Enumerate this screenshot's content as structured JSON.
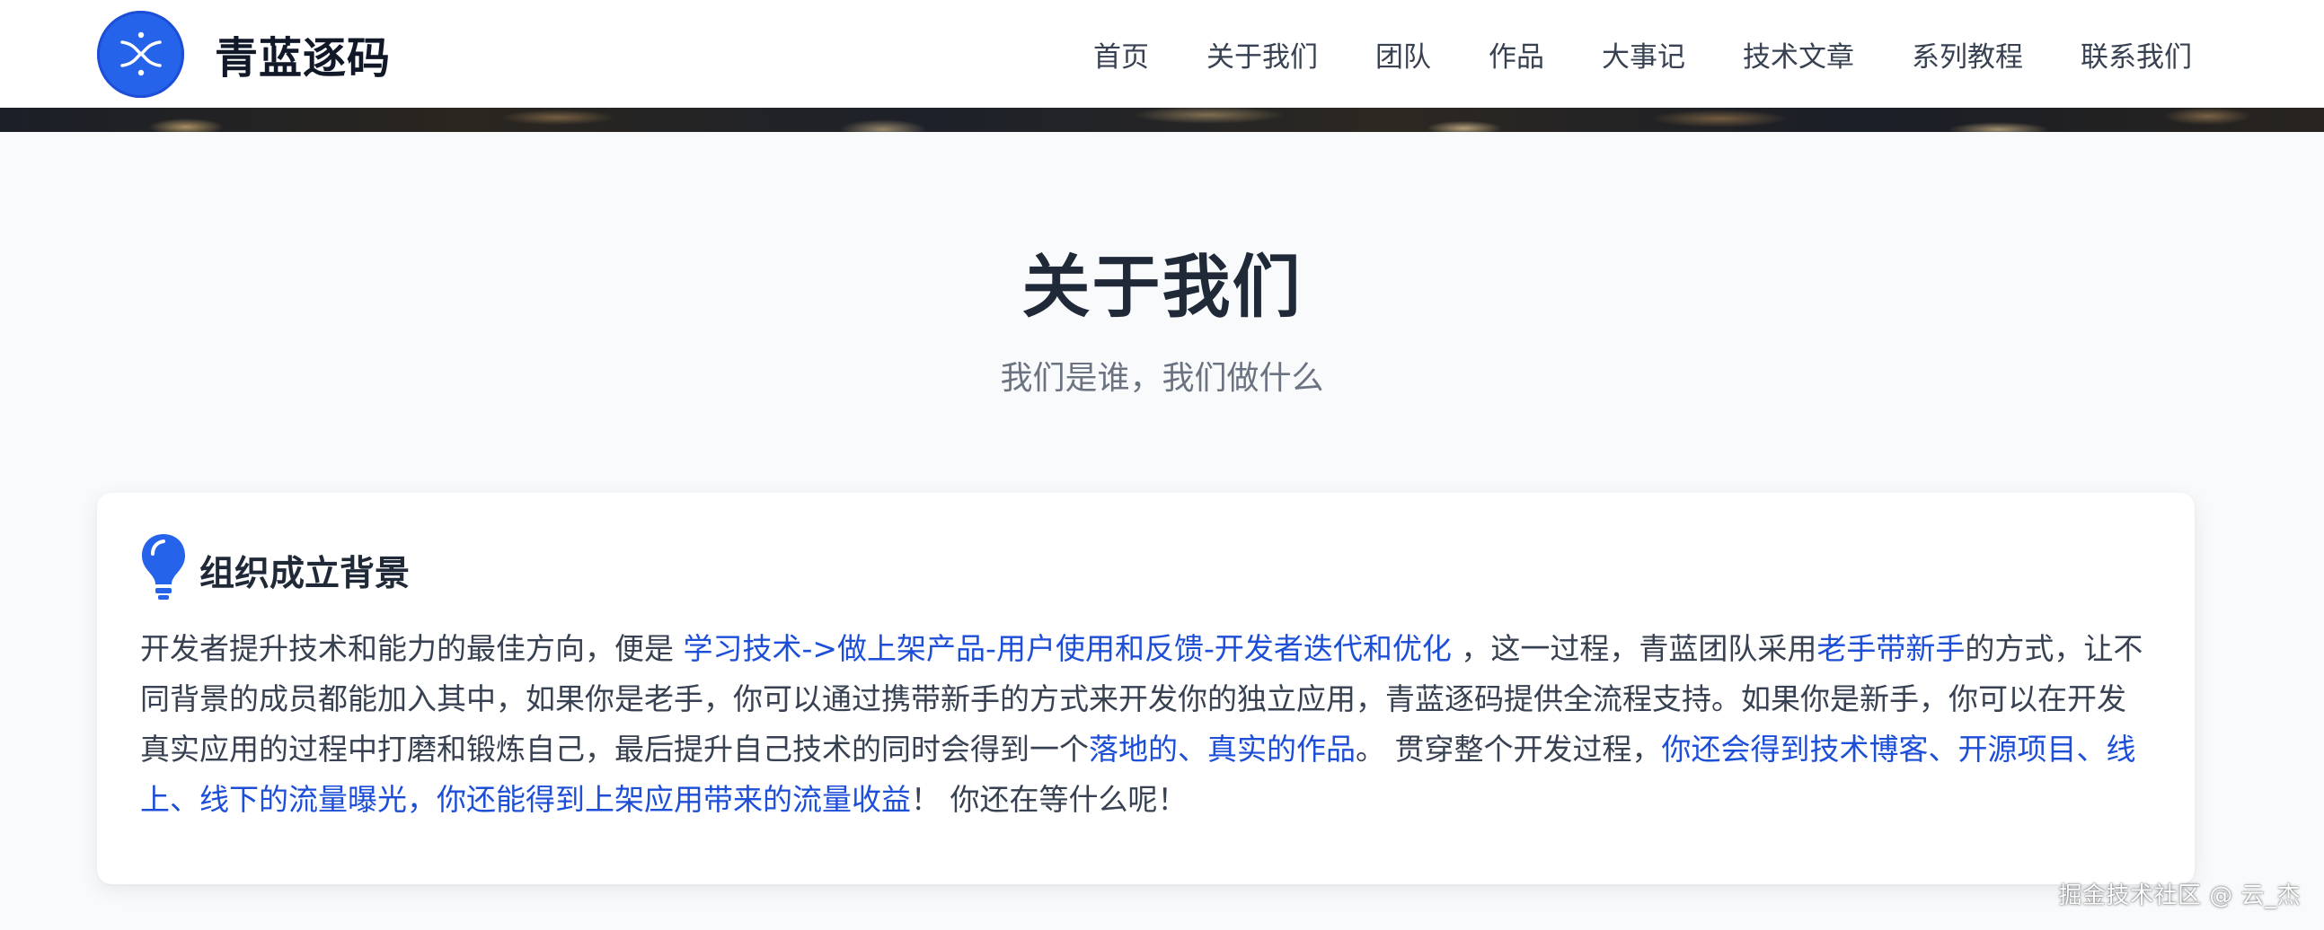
{
  "header": {
    "brand_name": "青蓝逐码",
    "nav": [
      {
        "label": "首页"
      },
      {
        "label": "关于我们"
      },
      {
        "label": "团队"
      },
      {
        "label": "作品"
      },
      {
        "label": "大事记"
      },
      {
        "label": "技术文章"
      },
      {
        "label": "系列教程"
      },
      {
        "label": "联系我们"
      }
    ]
  },
  "section": {
    "title": "关于我们",
    "subtitle": "我们是谁，我们做什么"
  },
  "card": {
    "icon": "lightbulb-icon",
    "title": "组织成立背景",
    "segments": [
      {
        "text": "开发者提升技术和能力的最佳方向，便是 ",
        "hl": false
      },
      {
        "text": "学习技术->做上架产品-用户使用和反馈-开发者迭代和优化",
        "hl": true
      },
      {
        "text": " ，这一过程，青蓝团队采用",
        "hl": false
      },
      {
        "text": "老手带新手",
        "hl": true
      },
      {
        "text": "的方式，让不同背景的成员都能加入其中，如果你是老手，你可以通过携带新手的方式来开发你的独立应用，青蓝逐码提供全流程支持。如果你是新手，你可以在开发真实应用的过程中打磨和锻炼自己，最后提升自己技术的同时会得到一个",
        "hl": false
      },
      {
        "text": "落地的、真实的作品",
        "hl": true
      },
      {
        "text": "。 贯穿整个开发过程，",
        "hl": false
      },
      {
        "text": "你还会得到技术博客、开源项目、线上、线下的流量曝光，你还能得到上架应用带来的流量收益",
        "hl": true
      },
      {
        "text": "！ 你还在等什么呢！",
        "hl": false
      }
    ]
  },
  "watermark": "掘金技术社区 @ 云_杰",
  "colors": {
    "accent": "#2563eb",
    "link": "#1d4ed8",
    "page_bg": "#f8fafc"
  }
}
